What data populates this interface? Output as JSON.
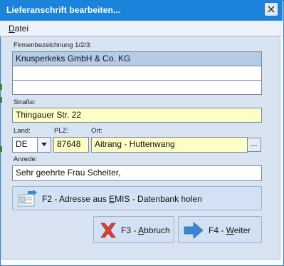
{
  "window": {
    "title": "Lieferanschrift bearbeiten..."
  },
  "menu": {
    "file_prefix": "",
    "file_underlined": "D",
    "file_rest": "atei"
  },
  "form": {
    "company_label": "Firmenbezeichnung 1/2/3:",
    "company_lines": [
      "Knusperkeks GmbH & Co. KG",
      "",
      ""
    ],
    "street_label": "Straße:",
    "street_value": "Thingauer Str. 22",
    "country_label": "Land:",
    "country_value": "DE",
    "zip_label": "PLZ:",
    "zip_value": "87648",
    "city_label": "Ort:",
    "city_value": "Aitrang - Huttenwang",
    "ellipsis_label": "...",
    "salutation_label": "Anrede:",
    "salutation_value": "Sehr geehrte Frau Schelter,"
  },
  "buttons": {
    "emis_pre": "F2 - Adresse aus ",
    "emis_ul": "E",
    "emis_post": "MIS - Datenbank holen",
    "cancel_pre": "F3 - ",
    "cancel_ul": "A",
    "cancel_post": "bbruch",
    "next_pre": "F4 - ",
    "next_ul": "W",
    "next_post": "eiter"
  },
  "icons": {
    "close": "close-icon",
    "emis": "address-database-icon",
    "cancel": "cancel-x-icon",
    "next": "arrow-right-icon"
  },
  "colors": {
    "titlebar": "#1c83db",
    "field_highlight": "#fdfdc5",
    "selected": "#b5cbe6"
  }
}
